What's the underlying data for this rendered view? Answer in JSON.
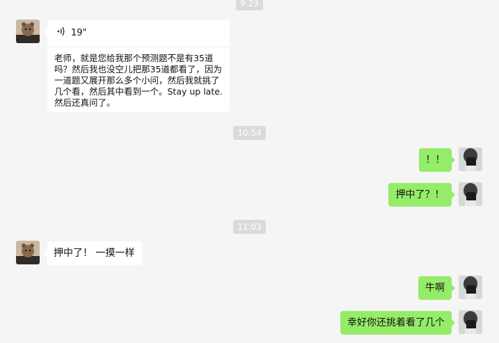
{
  "chat": {
    "time_1": "9:23",
    "time_2": "10:54",
    "time_3": "11:03",
    "voice_duration": "19\"",
    "voice_transcript": "老师，就是您给我那个预测题不是有35道吗？然后我也没空儿把那35道都看了，因为一道题又展开那么多个小问，然后我就挑了几个看，然后其中看到一个。Stay up late.然后还真问了。",
    "msg_out_1": "！！",
    "msg_out_2": "押中了？！",
    "msg_in_2": "押中了！ 一摸一样",
    "msg_out_3": "牛啊",
    "msg_out_4": "幸好你还挑着看了几个"
  },
  "icons": {
    "voice": "voice-wave-icon"
  },
  "colors": {
    "background": "#f5f5f5",
    "incoming_bubble": "#ffffff",
    "outgoing_bubble": "#95ec69",
    "timestamp_bg": "#dadada"
  }
}
